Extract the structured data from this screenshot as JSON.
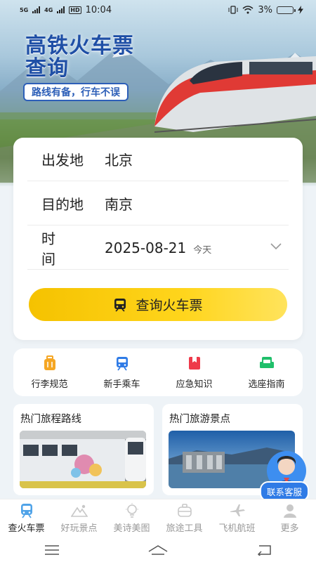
{
  "status_bar": {
    "net1": "5G",
    "net2": "4G",
    "hd": "HD",
    "time": "10:04",
    "battery_pct": "3%"
  },
  "hero": {
    "title_line1": "高铁火车票",
    "title_line2": "查询",
    "slogan": "路线有备，行车不误"
  },
  "search": {
    "from_label": "出发地",
    "from_value": "北京",
    "to_label": "目的地",
    "to_value": "南京",
    "time_label": "时间",
    "date_value": "2025-08-21",
    "date_hint": "今天",
    "button_label": "查询火车票"
  },
  "quick_links": [
    {
      "label": "行李规范",
      "icon": "luggage-icon",
      "color": "#f5a623"
    },
    {
      "label": "新手乘车",
      "icon": "train-icon",
      "color": "#2f7be6"
    },
    {
      "label": "应急知识",
      "icon": "bookmark-icon",
      "color": "#ee3a4a"
    },
    {
      "label": "选座指南",
      "icon": "seat-icon",
      "color": "#1fbf6a"
    }
  ],
  "cards": {
    "routes_title": "热门旅程路线",
    "spots_title": "热门旅游景点"
  },
  "service": {
    "label": "联系客服"
  },
  "bottom_nav": [
    {
      "label": "查火车票",
      "icon": "train-ticket-icon",
      "active": true
    },
    {
      "label": "好玩景点",
      "icon": "mountain-icon",
      "active": false
    },
    {
      "label": "美诗美图",
      "icon": "lightbulb-icon",
      "active": false
    },
    {
      "label": "旅途工具",
      "icon": "toolbox-icon",
      "active": false
    },
    {
      "label": "飞机航班",
      "icon": "airplane-icon",
      "active": false
    },
    {
      "label": "更多",
      "icon": "person-icon",
      "active": false
    }
  ],
  "colors": {
    "accent_yellow": "#ffd51c",
    "brand_blue": "#2f7be6",
    "title_blue": "#1f4fa6"
  }
}
